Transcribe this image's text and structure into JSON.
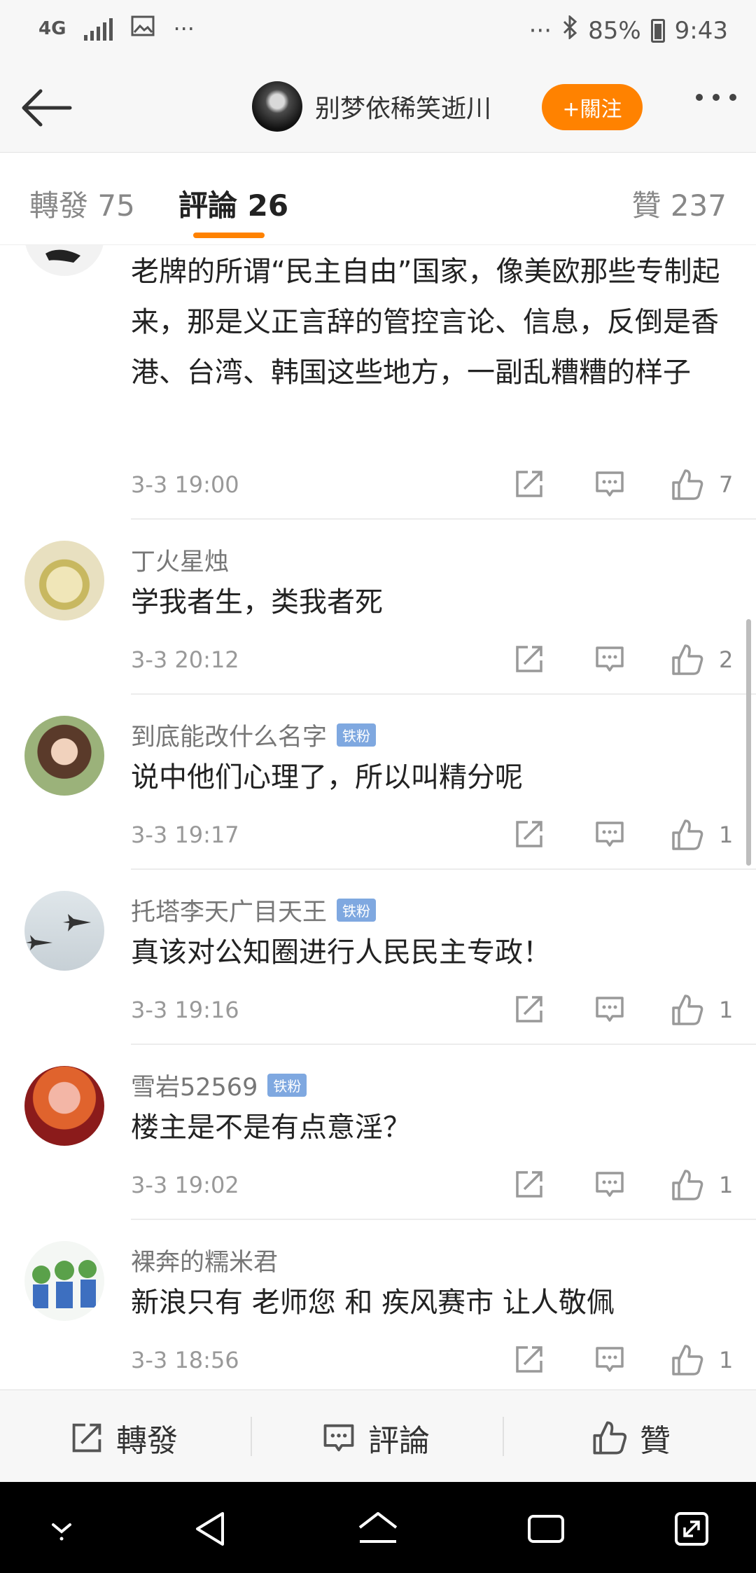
{
  "status_bar": {
    "network": "4G",
    "battery": "85%",
    "time": "9:43"
  },
  "header": {
    "username": "别梦依稀笑逝川",
    "follow_label": "+關注"
  },
  "tabs": [
    {
      "label": "轉發 75"
    },
    {
      "label": "評論 26"
    },
    {
      "label": "贊 237"
    }
  ],
  "comments": [
    {
      "name": "",
      "text": "老牌的所谓“民主自由”国家，像美欧那些专制起来，那是义正言辞的管控言论、信息，反倒是香港、台湾、韩国这些地方，一副乱糟糟的样子",
      "time": "3-3 19:00",
      "likes": "7",
      "badge": ""
    },
    {
      "name": "丁火星烛",
      "text": "学我者生，类我者死",
      "time": "3-3 20:12",
      "likes": "2",
      "badge": ""
    },
    {
      "name": "到底能改什么名字",
      "text": "说中他们心理了，所以叫精分呢",
      "time": "3-3 19:17",
      "likes": "1",
      "badge": "铁粉"
    },
    {
      "name": "托塔李天广目天王",
      "text": "真该对公知圈进行人民民主专政！",
      "time": "3-3 19:16",
      "likes": "1",
      "badge": "铁粉"
    },
    {
      "name": "雪岩52569",
      "text": "楼主是不是有点意淫？",
      "time": "3-3 19:02",
      "likes": "1",
      "badge": "铁粉"
    },
    {
      "name": "裸奔的糯米君",
      "text": "新浪只有 老师您 和 疾风赛市 让人敬佩",
      "time": "3-3 18:56",
      "likes": "1",
      "badge": ""
    }
  ],
  "bottom_bar": {
    "repost": "轉發",
    "comment": "評論",
    "like": "贊"
  },
  "colors": {
    "accent": "#ff8200",
    "badge": "#7fa8e0"
  }
}
